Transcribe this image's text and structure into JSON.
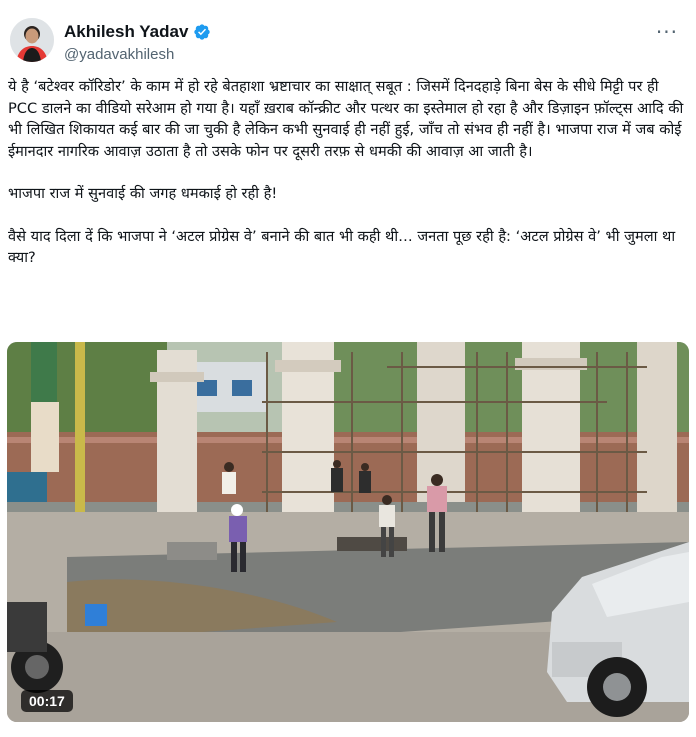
{
  "author": {
    "name": "Akhilesh Yadav",
    "handle": "@yadavakhilesh"
  },
  "icons": {
    "verified": "verified-badge-icon",
    "more": "more-options-icon",
    "verified_color": "#1d9bf0"
  },
  "tweet": {
    "paragraphs": [
      "ये है ‘बटेश्वर कॉरिडोर’ के काम में हो रहे बेतहाशा भ्रष्टाचार का साक्षात् सबूत : जिसमें दिनदहाड़े बिना बेस के सीधे मिट्टी पर ही PCC डालने का वीडियो सरेआम हो गया है। यहाँ ख़राब कॉन्क्रीट और पत्थर का इस्तेमाल हो रहा है और डिज़ाइन फ़ॉल्ट्स आदि की भी लिखित शिकायत कई बार की जा चुकी है लेकिन कभी सुनवाई ही नहीं हुई, जाँच तो संभव ही नहीं है। भाजपा राज में जब कोई ईमानदार नागरिक आवाज़ उठाता है तो उसके फोन पर दूसरी तरफ़ से धमकी की आवाज़ आ जाती है।",
      "भाजपा राज में सुनवाई की जगह धमकाई हो रही है!",
      "वैसे याद दिला दें कि भाजपा ने ‘अटल प्रोग्रेस वे’ बनाने की बात भी कही थी… जनता पूछ रही है: ‘अटल प्रोग्रेस वे’ भी जुमला था क्या?"
    ]
  },
  "video": {
    "duration": "00:17"
  }
}
